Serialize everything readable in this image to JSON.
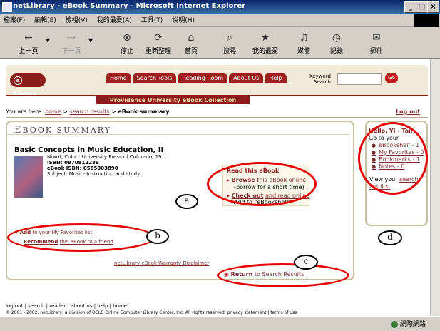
{
  "window": {
    "title": "netLibrary - eBook Summary - Microsoft Internet Explorer",
    "min_label": "_",
    "max_label": "□",
    "close_label": "×"
  },
  "menu": [
    "檔案(F)",
    "編輯(E)",
    "檢視(V)",
    "我的最愛(A)",
    "工具(T)",
    "說明(H)"
  ],
  "toolbar": [
    {
      "label": "上一頁",
      "icon": "←"
    },
    {
      "label": "下一頁",
      "icon": "→"
    },
    {
      "label": "停止",
      "icon": "⊗"
    },
    {
      "label": "重新整理",
      "icon": "⟳"
    },
    {
      "label": "首頁",
      "icon": "⌂"
    },
    {
      "label": "搜尋",
      "icon": "⌕"
    },
    {
      "label": "我的最愛",
      "icon": "★"
    },
    {
      "label": "媒體",
      "icon": "♫"
    },
    {
      "label": "記錄",
      "icon": "◷"
    },
    {
      "label": "郵件",
      "icon": "✉"
    }
  ],
  "site": {
    "logo": "Library",
    "logo_e": "e",
    "nav": [
      "Home",
      "Search Tools",
      "Reading Room",
      "About Us",
      "Help"
    ],
    "keyword_label_1": "Keyword",
    "keyword_label_2": "Search",
    "go_label": "Go",
    "collection": "Providence University eBook Collection"
  },
  "breadcrumb": {
    "prefix": "You are here:",
    "home": "home",
    "sep": ">",
    "results": "search results",
    "current": "eBook summary"
  },
  "logout": "Log out",
  "summary": {
    "title_first": "E",
    "title_rest": "BOOK SUMMARY",
    "book_title": "Basic Concepts in Music Education, II",
    "publisher": "Niwot, Colo. : University Press of Colorado, 19...",
    "isbn": "ISBN: 0870812289",
    "ebook_isbn": "eBook ISBN: 0585003890",
    "subject": "Subject: Music--Instruction and study"
  },
  "read": {
    "title": "Read this eBook",
    "browse_bold": "Browse",
    "browse_rest": "this eBook online",
    "browse_note": "(borrow for a short time)",
    "checkout_bold": "Check out",
    "checkout_rest": "and read online",
    "add_note": "Add to \"eBookshelf\""
  },
  "links": {
    "return_bold": "Return",
    "return_rest": "to Search Results",
    "add_bold": "Add",
    "add_rest": "to your My Favorites list",
    "recommend_bold": "Recommend",
    "recommend_rest": "this eBook to a friend",
    "warranty": "netLibrary eBook Warranty Disclaimer"
  },
  "user": {
    "name": "Hello, Yi - Tai.",
    "goto": "Go to your",
    "items": [
      "eBookshelf - 1",
      "My Favorites - 0",
      "Bookmarks - 1",
      "Notes - 0"
    ],
    "view_prefix": "View your",
    "view_link": "search results."
  },
  "callouts": [
    "a",
    "b",
    "c",
    "d"
  ],
  "footer": {
    "links": "log out | search | reader | about us | help | home",
    "copyright": "© 2001 - 2002, netLibrary, a division of OCLC Online Computer Library Center, Inc.  All rights reserved.  privacy statement | terms of use"
  },
  "status": {
    "zone": "網際網路"
  },
  "colors": {
    "accent": "#8b1c1c",
    "callout": "#e60000"
  }
}
